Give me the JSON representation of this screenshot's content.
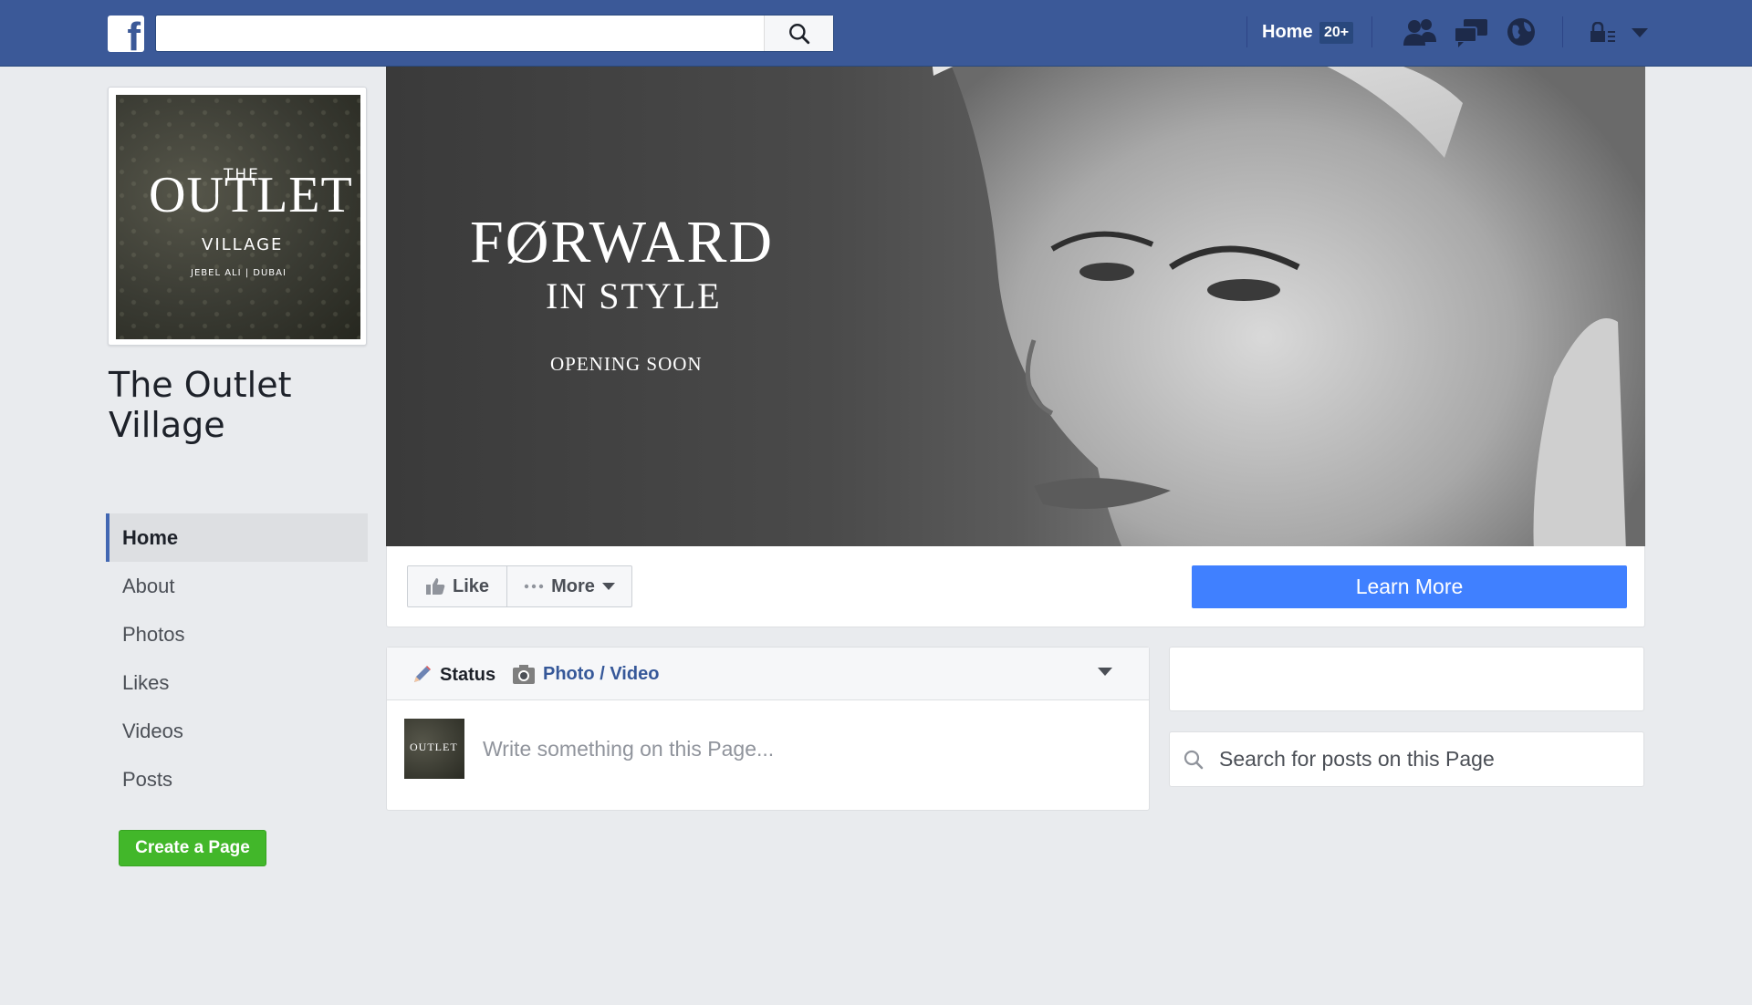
{
  "topbar": {
    "logo": "f",
    "search": {
      "value": "",
      "placeholder": ""
    },
    "home_label": "Home",
    "home_badge": "20+",
    "icons": [
      "friend-requests-icon",
      "messages-icon",
      "notifications-globe-icon",
      "privacy-shortcuts-icon",
      "account-menu-caret-icon"
    ]
  },
  "page": {
    "name": "The Outlet Village",
    "profile_logo": {
      "the": "THE",
      "outlet": "OUTLET",
      "village": "VILLAGE",
      "location": "JEBEL ALI | DUBAI"
    }
  },
  "sidebar": {
    "items": [
      {
        "label": "Home",
        "active": true
      },
      {
        "label": "About"
      },
      {
        "label": "Photos"
      },
      {
        "label": "Likes"
      },
      {
        "label": "Videos"
      },
      {
        "label": "Posts"
      }
    ],
    "create_page": "Create a Page"
  },
  "cover": {
    "title_line1": "FØRWARD",
    "title_line2": "IN STYLE",
    "subtitle": "OPENING SOON"
  },
  "actions": {
    "like": "Like",
    "more": "More",
    "cta": "Learn More"
  },
  "composer": {
    "tab_status": "Status",
    "tab_photo": "Photo / Video",
    "placeholder": "Write something on this Page...",
    "avatar_mark": "OUTLET"
  },
  "right": {
    "search_placeholder": "Search for posts on this Page"
  },
  "colors": {
    "brand_blue": "#3b5998",
    "cta_blue": "#4080ff",
    "create_green": "#42b72a",
    "background": "#e9ebee"
  }
}
